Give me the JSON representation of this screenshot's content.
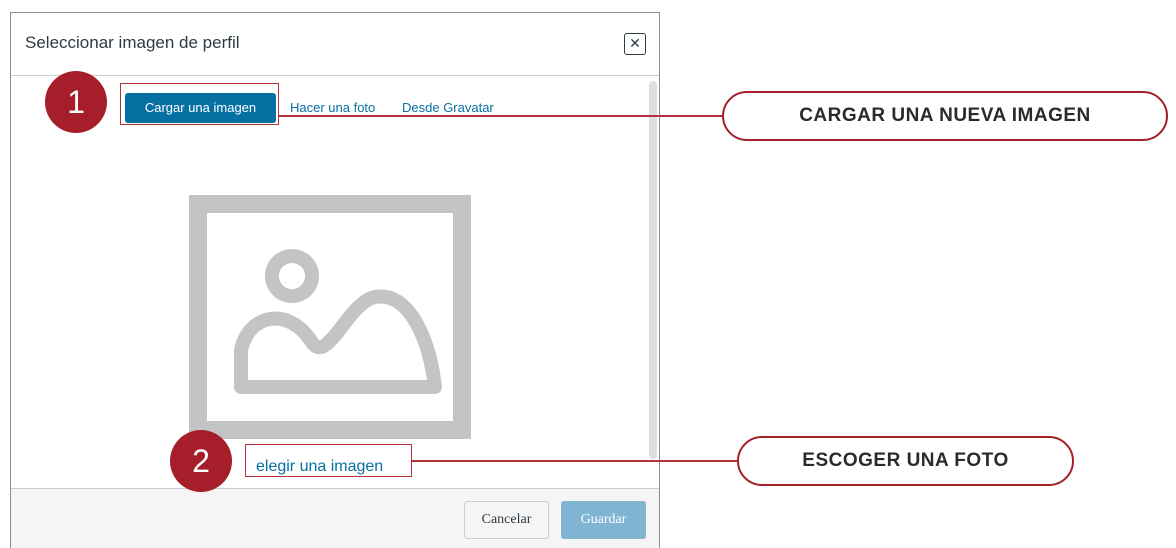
{
  "dialog": {
    "title": "Seleccionar imagen de perfil",
    "close_icon": "close-icon",
    "tabs": [
      {
        "label": "Cargar una imagen",
        "active": true
      },
      {
        "label": "Hacer una foto",
        "active": false
      },
      {
        "label": "Desde Gravatar",
        "active": false
      }
    ],
    "placeholder_icon": "image-placeholder-icon",
    "choose_link": "elegir una imagen",
    "footer": {
      "cancel_label": "Cancelar",
      "save_label": "Guardar"
    }
  },
  "annotations": {
    "markers": [
      "1",
      "2"
    ],
    "callouts": [
      "CARGAR UNA NUEVA IMAGEN",
      "ESCOGER UNA FOTO"
    ]
  },
  "colors": {
    "accent": "#0770a3",
    "save_disabled": "#7fb4d3",
    "annotation": "#a61e2a",
    "placeholder": "#c4c4c4"
  }
}
